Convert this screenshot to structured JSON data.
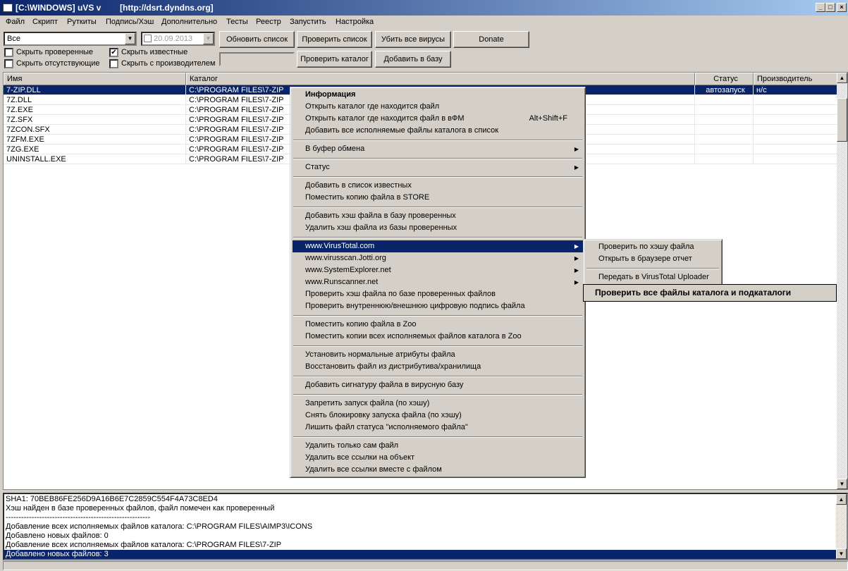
{
  "window": {
    "title": "[C:\\WINDOWS] uVS v        [http://dsrt.dyndns.org]",
    "min": "_",
    "max": "□",
    "close": "×"
  },
  "menubar": [
    "Файл",
    "Скрипт",
    "Руткиты",
    "Подпись/Хэш",
    "Дополнительно",
    "Тесты",
    "Реестр",
    "Запустить",
    "Настройка"
  ],
  "toolbar": {
    "filter_value": "Все",
    "date_value": "20.09.2013",
    "date_checked": false,
    "buttons": {
      "refresh": "Обновить список",
      "check_list": "Проверить список",
      "kill_all": "Убить все вирусы",
      "donate": "Donate",
      "check_dir": "Проверить каталог",
      "add_db": "Добавить в базу"
    },
    "checkboxes": [
      {
        "label": "Скрыть проверенные",
        "checked": false
      },
      {
        "label": "Скрыть известные",
        "checked": true
      },
      {
        "label": "Скрыть отсутствующие",
        "checked": false
      },
      {
        "label": "Скрыть с производителем",
        "checked": false
      }
    ],
    "search_value": ""
  },
  "table": {
    "columns": [
      "Имя",
      "Каталог",
      "Статус",
      "Производитель"
    ],
    "rows": [
      {
        "name": "7-ZIP.DLL",
        "dir": "C:\\PROGRAM FILES\\7-ZIP",
        "status": "автозапуск",
        "vendor": "н/с",
        "selected": true
      },
      {
        "name": "7Z.DLL",
        "dir": "C:\\PROGRAM FILES\\7-ZIP",
        "status": "",
        "vendor": ""
      },
      {
        "name": "7Z.EXE",
        "dir": "C:\\PROGRAM FILES\\7-ZIP",
        "status": "",
        "vendor": ""
      },
      {
        "name": "7Z.SFX",
        "dir": "C:\\PROGRAM FILES\\7-ZIP",
        "status": "",
        "vendor": ""
      },
      {
        "name": "7ZCON.SFX",
        "dir": "C:\\PROGRAM FILES\\7-ZIP",
        "status": "",
        "vendor": ""
      },
      {
        "name": "7ZFM.EXE",
        "dir": "C:\\PROGRAM FILES\\7-ZIP",
        "status": "",
        "vendor": ""
      },
      {
        "name": "7ZG.EXE",
        "dir": "C:\\PROGRAM FILES\\7-ZIP",
        "status": "",
        "vendor": ""
      },
      {
        "name": "UNINSTALL.EXE",
        "dir": "C:\\PROGRAM FILES\\7-ZIP",
        "status": "",
        "vendor": ""
      }
    ]
  },
  "context_menu": [
    {
      "label": "Информация",
      "bold": true
    },
    {
      "label": "Открыть каталог где находится файл"
    },
    {
      "label": "Открыть каталог где находится файл в вФМ",
      "shortcut": "Alt+Shift+F"
    },
    {
      "label": "Добавить все исполняемые файлы каталога в список"
    },
    {
      "sep": true
    },
    {
      "label": "В буфер обмена",
      "submenu": true
    },
    {
      "sep": true
    },
    {
      "label": "Статус",
      "submenu": true
    },
    {
      "sep": true
    },
    {
      "label": "Добавить в список известных"
    },
    {
      "label": "Поместить копию файла в STORE"
    },
    {
      "sep": true
    },
    {
      "label": "Добавить хэш файла в базу проверенных"
    },
    {
      "label": "Удалить хэш файла из базы проверенных"
    },
    {
      "sep": true
    },
    {
      "label": "www.VirusTotal.com",
      "submenu": true,
      "highlighted": true
    },
    {
      "label": "www.virusscan.Jotti.org",
      "submenu": true
    },
    {
      "label": "www.SystemExplorer.net",
      "submenu": true
    },
    {
      "label": "www.Runscanner.net",
      "submenu": true
    },
    {
      "label": "Проверить хэш файла по базе проверенных файлов"
    },
    {
      "label": "Проверить внутреннюю/внешнюю цифровую подпись файла"
    },
    {
      "sep": true
    },
    {
      "label": "Поместить копию файла в Zoo"
    },
    {
      "label": "Поместить копии всех исполняемых файлов каталога в Zoo"
    },
    {
      "sep": true
    },
    {
      "label": "Установить нормальные атрибуты файла"
    },
    {
      "label": "Восстановить файл из дистрибутива/хранилища"
    },
    {
      "sep": true
    },
    {
      "label": "Добавить сигнатуру файла в вирусную базу"
    },
    {
      "sep": true
    },
    {
      "label": "Запретить запуск файла (по хэшу)"
    },
    {
      "label": "Снять блокировку запуска файла (по хэшу)"
    },
    {
      "label": "Лишить файл статуса \"исполняемого файла\""
    },
    {
      "sep": true
    },
    {
      "label": "Удалить только сам файл"
    },
    {
      "label": "Удалить все ссылки на объект"
    },
    {
      "label": "Удалить все ссылки вместе с файлом"
    }
  ],
  "submenu": [
    {
      "label": "Проверить по хэшу файла"
    },
    {
      "label": "Открыть в браузере отчет"
    },
    {
      "sep": true
    },
    {
      "label": "Передать в VirusTotal Uploader"
    }
  ],
  "tooltip": "Проверить все файлы каталога и подкаталоги",
  "log": [
    "SHA1: 70BEB86FE256D9A16B6E7C2859C554F4A73C8ED4",
    "Хэш найден в базе проверенных файлов, файл помечен как проверенный",
    "--------------------------------------------------------",
    "Добавление всех исполняемых файлов каталога: C:\\PROGRAM FILES\\AIMP3\\ICONS",
    "Добавлено новых файлов: 0",
    "Добавление всех исполняемых файлов каталога: C:\\PROGRAM FILES\\7-ZIP",
    "Добавлено новых файлов: 3"
  ],
  "log_selected_index": 6,
  "colors": {
    "selection": "#0a246a",
    "face": "#d4d0c8"
  }
}
